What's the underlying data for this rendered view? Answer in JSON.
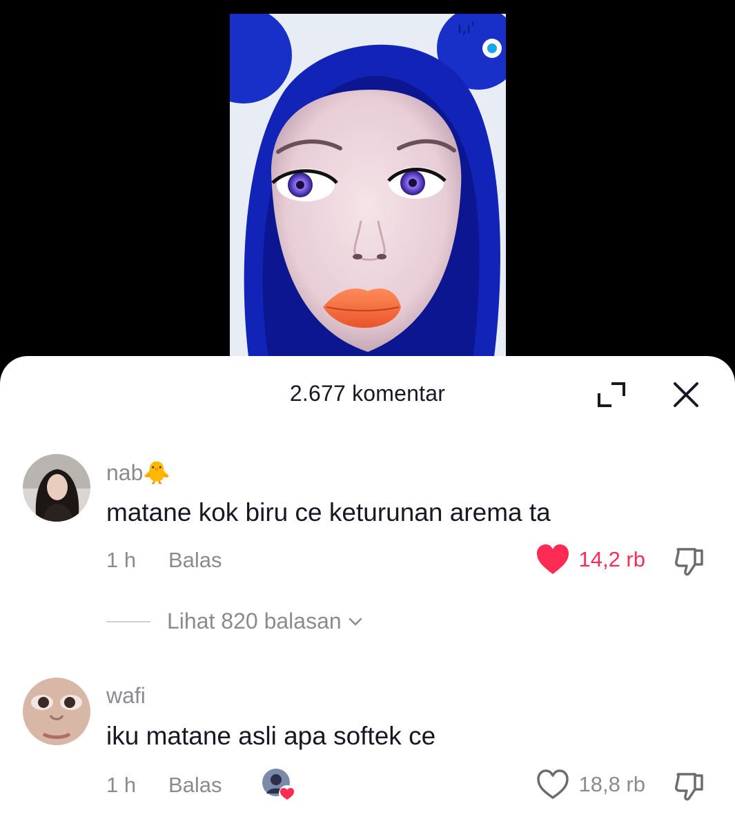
{
  "header": {
    "title": "2.677 komentar"
  },
  "comments": [
    {
      "username": "nab🐥",
      "text": "matane kok biru ce keturunan arema ta",
      "time": "1 h",
      "reply_label": "Balas",
      "likes": "14,2 rb",
      "liked": true,
      "view_replies": "Lihat 820 balasan"
    },
    {
      "username": "wafi",
      "text": "iku matane asli apa softek ce",
      "time": "1 h",
      "reply_label": "Balas",
      "likes": "18,8 rb",
      "liked": false,
      "liked_by_creator": true
    }
  ],
  "colors": {
    "like_active": "#fe2c55",
    "muted_text": "#8a8b91",
    "primary_text": "#161823"
  }
}
